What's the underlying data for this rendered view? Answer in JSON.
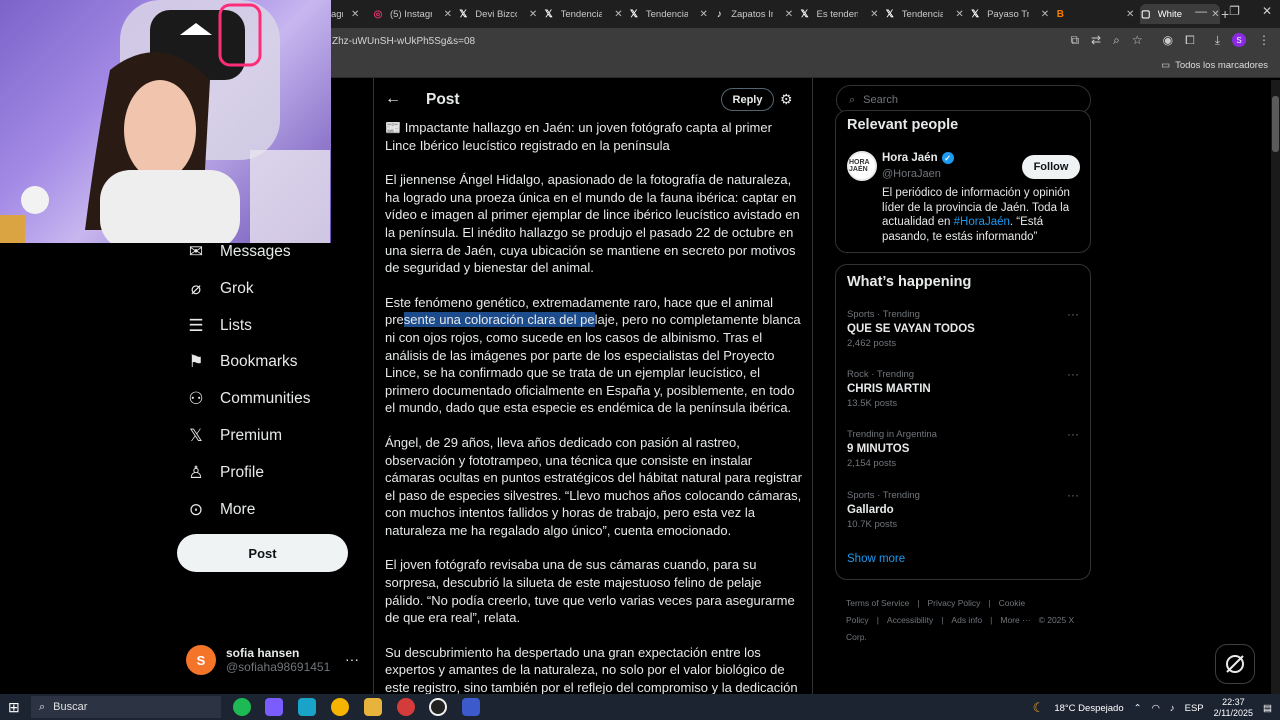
{
  "browser": {
    "tabs": [
      {
        "icon": "instagram-icon",
        "label": "(5) Instagr",
        "color": "#e1306c"
      },
      {
        "icon": "x-logo-icon",
        "label": "Devi Bizco",
        "color": "#000000"
      },
      {
        "icon": "x-logo-icon",
        "label": "Tendencias",
        "color": "#000000"
      },
      {
        "icon": "x-logo-icon",
        "label": "Tendencias",
        "color": "#000000"
      },
      {
        "icon": "tiktok-icon",
        "label": "Zapatos In",
        "color": "#000000"
      },
      {
        "icon": "x-logo-icon",
        "label": "Es tenden",
        "color": "#000000"
      },
      {
        "icon": "x-logo-icon",
        "label": "Tendencias",
        "color": "#000000"
      },
      {
        "icon": "x-logo-icon",
        "label": "Payaso Tri",
        "color": "#000000"
      },
      {
        "icon": "blogger-icon",
        "label": "",
        "color": "#f57d00"
      },
      {
        "icon": "page-icon",
        "label": "White",
        "color": "#ffffff"
      }
    ],
    "partial_tab_label": "agr",
    "url_fragment": "Zhz-uWUnSH-wUkPh5Sg&s=08",
    "bookmarks_label": "Todos los marcadores",
    "profile_initial": "S"
  },
  "sidebar": {
    "items": [
      {
        "icon": "envelope-icon",
        "label": "Messages"
      },
      {
        "icon": "grok-icon",
        "label": "Grok"
      },
      {
        "icon": "list-icon",
        "label": "Lists"
      },
      {
        "icon": "bookmark-icon",
        "label": "Bookmarks"
      },
      {
        "icon": "communities-icon",
        "label": "Communities"
      },
      {
        "icon": "x-logo-icon",
        "label": "Premium"
      },
      {
        "icon": "person-icon",
        "label": "Profile"
      },
      {
        "icon": "more-circle-icon",
        "label": "More"
      }
    ],
    "post_button": "Post",
    "account": {
      "initial": "S",
      "name": "sofia hansen",
      "handle": "@sofiaha98691451"
    }
  },
  "post": {
    "header_title": "Post",
    "reply_button": "Reply",
    "headline": "📰 Impactante hallazgo en Jaén: un joven fotógrafo capta al primer Lince Ibérico leucístico registrado en la península",
    "p1": "El jiennense Ángel Hidalgo, apasionado de la fotografía de naturaleza, ha logrado una proeza única en el mundo de la fauna ibérica: captar en vídeo e imagen al primer ejemplar de lince ibérico leucístico avistado en la península. El inédito hallazgo se produjo el pasado 22 de octubre en una sierra de Jaén, cuya ubicación se mantiene en secreto por motivos de seguridad y bienestar del animal.",
    "p2_before": "Este fenómeno genético, extremadamente raro, hace que el animal pre",
    "p2_highlight": "sente una coloración clara del pe",
    "p2_after": "laje, pero no completamente blanca ni con ojos rojos, como sucede en los casos de albinismo. Tras el análisis de las imágenes por parte de los especialistas del Proyecto Lince, se ha confirmado que se trata de un ejemplar leucístico, el primero documentado oficialmente en España y, posiblemente, en todo el mundo, dado que esta especie es endémica de la península ibérica.",
    "p3": "Ángel, de 29 años, lleva años dedicado con pasión al rastreo, observación y fototrampeo, una técnica que consiste en instalar cámaras ocultas en puntos estratégicos del hábitat natural para registrar el paso de especies silvestres. “Llevo muchos años colocando cámaras, con muchos intentos fallidos y horas de trabajo, pero esta vez la naturaleza me ha regalado algo único”, cuenta emocionado.",
    "p4": "El joven fotógrafo revisaba una de sus cámaras cuando, para su sorpresa, descubrió la silueta de este majestuoso felino de pelaje pálido. “No podía creerlo, tuve que verlo varias veces para asegurarme de que era real”, relata.",
    "p5": "Su descubrimiento ha despertado una gran expectación entre los expertos y amantes de la naturaleza, no solo por el valor biológico de este registro, sino también por el reflejo del compromiso y la dedicación"
  },
  "right": {
    "search_placeholder": "Search",
    "relevant_title": "Relevant people",
    "person": {
      "avatar_text": "HORA JAÉN",
      "name": "Hora Jaén",
      "handle": "@HoraJaen",
      "follow": "Follow",
      "bio_before": "El periódico de información y opinión líder de la provincia de Jaén. Toda la actualidad en ",
      "bio_tag": "#HoraJaén",
      "bio_after": ". “Está pasando, te estás informando”"
    },
    "happening_title": "What’s happening",
    "trends": [
      {
        "category": "Sports · Trending",
        "name": "QUE SE VAYAN TODOS",
        "posts": "2,462 posts"
      },
      {
        "category": "Rock · Trending",
        "name": "CHRIS MARTIN",
        "posts": "13.5K posts"
      },
      {
        "category": "Trending in Argentina",
        "name": "9 MINUTOS",
        "posts": "2,154 posts"
      },
      {
        "category": "Sports · Trending",
        "name": "Gallardo",
        "posts": "10.7K posts"
      }
    ],
    "show_more": "Show more",
    "footer": [
      "Terms of Service",
      "|",
      "Privacy Policy",
      "|",
      "Cookie Policy",
      "|",
      "Accessibility",
      "|",
      "Ads info",
      "|",
      "More ···",
      "© 2025 X Corp."
    ]
  },
  "taskbar": {
    "search_label": "Buscar",
    "weather": "18°C  Despejado",
    "language": "ESP",
    "time": "22:37",
    "date": "2/11/2025"
  }
}
